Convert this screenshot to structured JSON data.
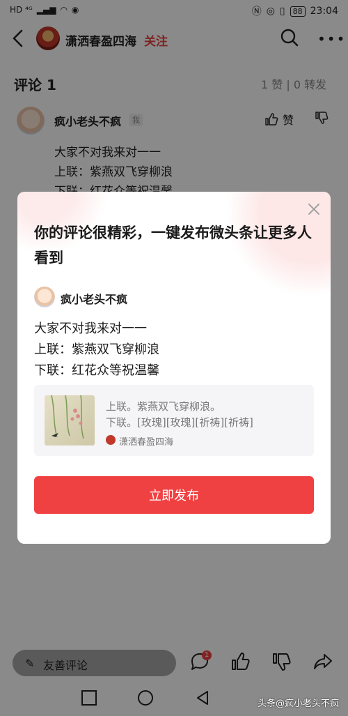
{
  "status_bar": {
    "left": "HD ⁴ᴳ",
    "battery": "88",
    "time": "23:04"
  },
  "header": {
    "author": "潇洒春盈四海",
    "follow_label": "关注"
  },
  "comments": {
    "title": "评论 1",
    "stats": "1 赞 | 0 转发"
  },
  "comment": {
    "user": "疯小老头不疯",
    "badge": "我",
    "like_label": "赞",
    "lines": [
      "大家不对我来对一一",
      "上联：紫燕双飞穿柳浪",
      "下联：红花众等祝温馨"
    ]
  },
  "modal": {
    "title": "你的评论很精彩，一键发布微头条让更多人看到",
    "user": "疯小老头不疯",
    "lines": [
      "大家不对我来对一一",
      "上联：紫燕双飞穿柳浪",
      "下联：红花众等祝温馨"
    ],
    "card": {
      "line1": "上联。紫燕双飞穿柳浪。",
      "line2": "下联。[玫瑰][玫瑰][祈祷][祈祷]",
      "source": "潇洒春盈四海"
    },
    "publish_label": "立即发布"
  },
  "bottom_bar": {
    "input_placeholder": "友善评论",
    "comment_badge": "1"
  },
  "watermark": "头条@疯小老头不疯",
  "colors": {
    "accent": "#f04142",
    "follow": "#e84342"
  }
}
